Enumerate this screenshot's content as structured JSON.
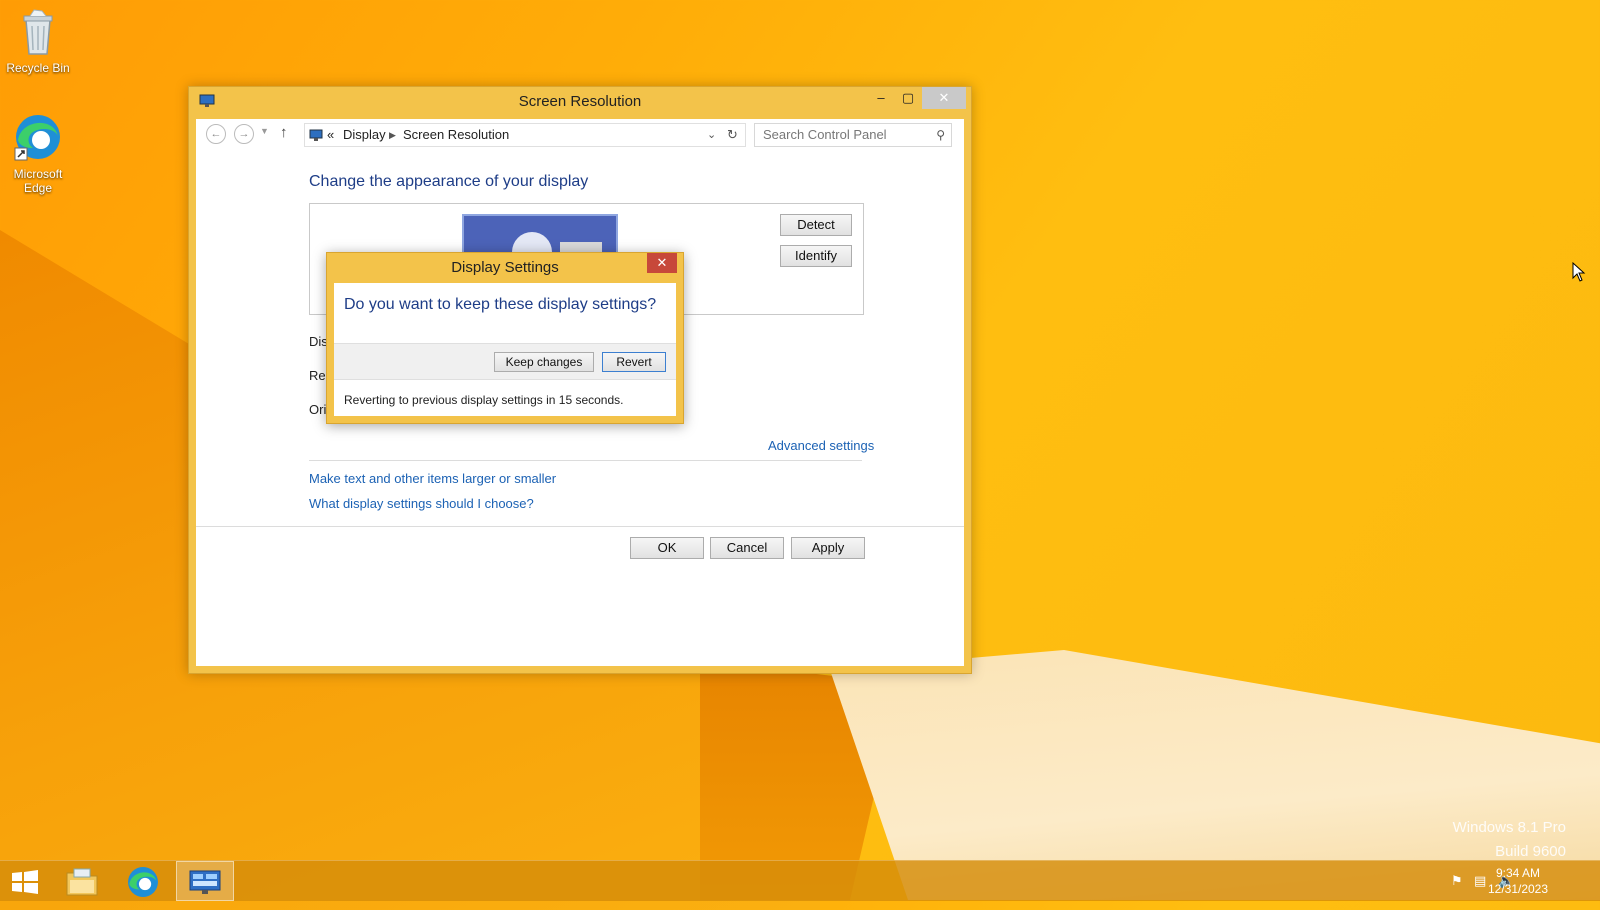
{
  "desktop": {
    "icons": [
      {
        "label": "Recycle Bin",
        "icon": "recycle-bin-icon"
      },
      {
        "label": "Microsoft Edge",
        "icon": "edge-icon"
      }
    ],
    "watermark_line1": "Windows 8.1 Pro",
    "watermark_line2": "Build 9600"
  },
  "window": {
    "title": "Screen Resolution",
    "breadcrumb_sep": "«",
    "breadcrumb": [
      "Display",
      "Screen Resolution"
    ],
    "search_placeholder": "Search Control Panel",
    "heading": "Change the appearance of your display",
    "detect_label": "Detect",
    "identify_label": "Identify",
    "field_labels": [
      "Dis",
      "Res",
      "Ori"
    ],
    "advanced_link": "Advanced settings",
    "links": [
      "Make text and other items larger or smaller",
      "What display settings should I choose?"
    ],
    "ok_label": "OK",
    "cancel_label": "Cancel",
    "apply_label": "Apply"
  },
  "dialog": {
    "title": "Display Settings",
    "question": "Do you want to keep these display settings?",
    "keep_label": "Keep changes",
    "revert_label": "Revert",
    "countdown_text": "Reverting to previous display settings in 15 seconds."
  },
  "taskbar": {
    "items": [
      "start-icon",
      "file-explorer-icon",
      "edge-icon",
      "control-panel-icon"
    ],
    "time": "9:34 AM",
    "date": "12/31/2023"
  },
  "colors": {
    "wallpaper": "#ffae08",
    "window_frame": "#f3c34a",
    "heading_blue": "#1e3d87",
    "link_blue": "#1c62b4"
  }
}
